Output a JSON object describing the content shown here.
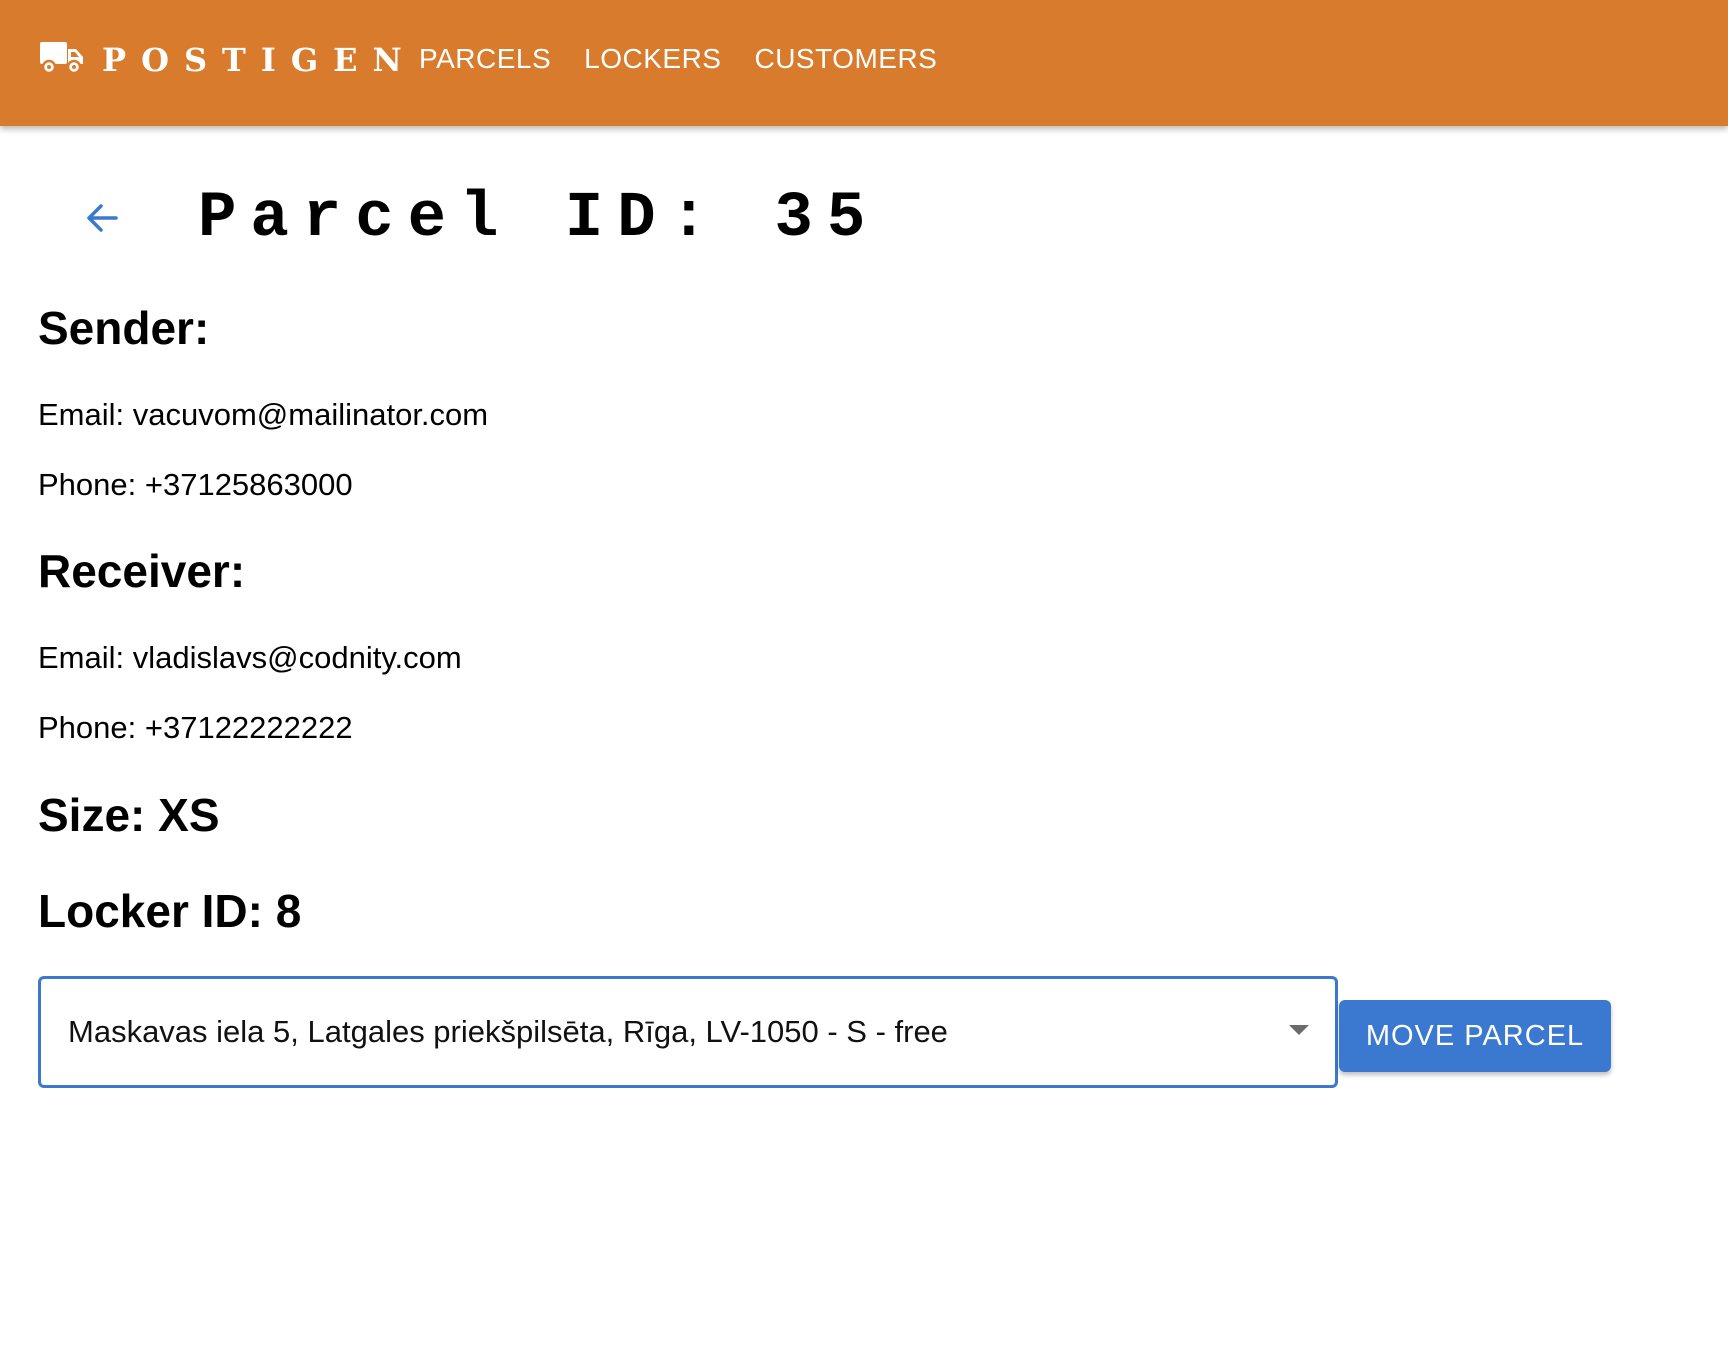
{
  "brand": {
    "name": "POSTIGEN",
    "icon": "truck-icon"
  },
  "nav": {
    "items": [
      {
        "label": "PARCELS"
      },
      {
        "label": "LOCKERS"
      },
      {
        "label": "CUSTOMERS"
      }
    ]
  },
  "page": {
    "back_icon": "arrow-left-icon",
    "title": "Parcel ID: 35"
  },
  "sender": {
    "heading": "Sender:",
    "email": "Email: vacuvom@mailinator.com",
    "phone": "Phone: +37125863000"
  },
  "receiver": {
    "heading": "Receiver:",
    "email": "Email: vladislavs@codnity.com",
    "phone": "Phone: +37122222222"
  },
  "size": {
    "text": "Size: XS"
  },
  "locker": {
    "text": "Locker ID: 8"
  },
  "move": {
    "selected_locker": "Maskavas iela 5, Latgales priekšpilsēta, Rīga, LV-1050 - S - free",
    "button_label": "MOVE PARCEL"
  },
  "colors": {
    "header_bg": "#d97b2d",
    "accent": "#3b78cf",
    "text": "#000000"
  }
}
